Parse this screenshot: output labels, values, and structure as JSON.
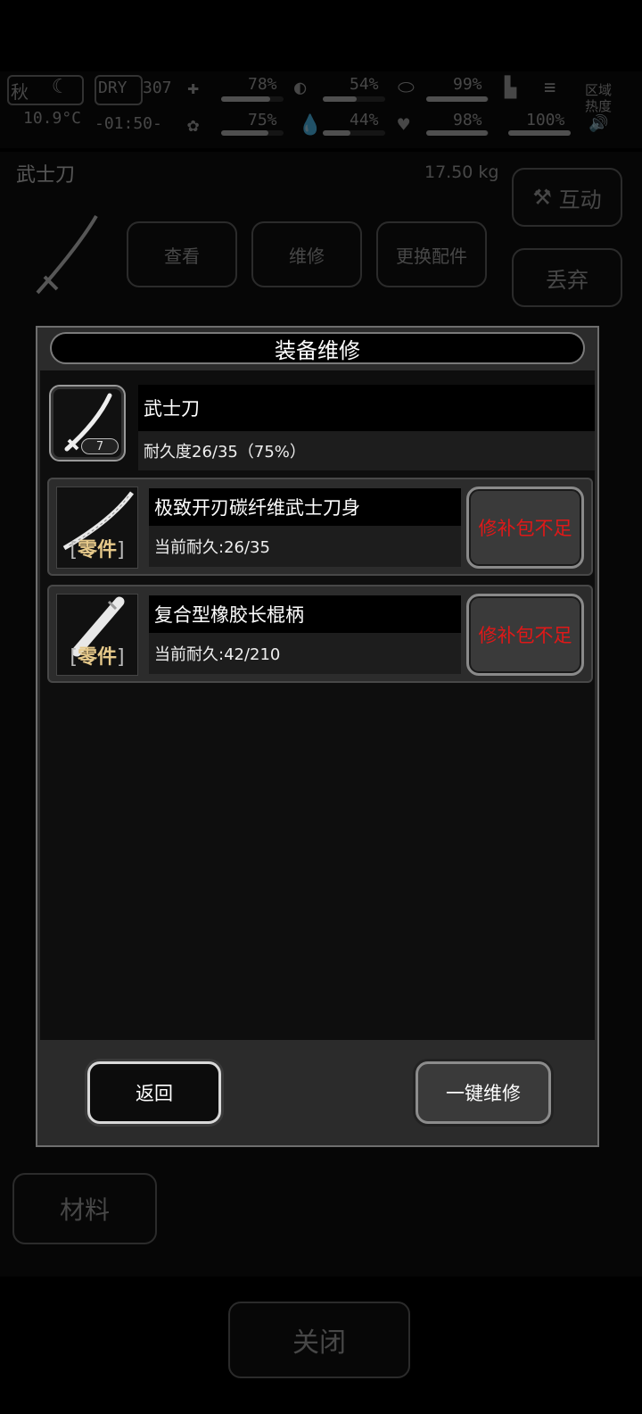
{
  "hud": {
    "season": "秋",
    "weather": "DRY",
    "weather_num": "307",
    "temperature": "10.9°C",
    "clock": "-01:50-",
    "stats": [
      {
        "name": "health",
        "value": "78%"
      },
      {
        "name": "hunger",
        "value": "54%"
      },
      {
        "name": "stomach",
        "value": "99%"
      },
      {
        "name": "stamina",
        "value": "100%"
      },
      {
        "name": "mind",
        "value": "75%"
      },
      {
        "name": "thirst",
        "value": "44%"
      },
      {
        "name": "heart",
        "value": "98%"
      }
    ],
    "zone_label": "区域热度"
  },
  "background": {
    "item_name": "武士刀",
    "item_weight": "17.50 kg",
    "btn_view": "查看",
    "btn_repair": "维修",
    "btn_swap": "更换配件",
    "btn_interact": "互动",
    "btn_discard": "丢弃",
    "side_material": "材料",
    "btn_close": "关闭"
  },
  "modal": {
    "title": "装备维修",
    "item": {
      "name": "武士刀",
      "level": "7",
      "durability": "耐久度26/35（75%）"
    },
    "parts": [
      {
        "name": "极致开刃碳纤维武士刀身",
        "tag": "零件",
        "durability": "当前耐久:26/35",
        "status": "修补包不足",
        "icon": "blade-icon"
      },
      {
        "name": "复合型橡胶长棍柄",
        "tag": "零件",
        "durability": "当前耐久:42/210",
        "status": "修补包不足",
        "icon": "handle-icon"
      }
    ],
    "back": "返回",
    "repair_all": "一键维修"
  },
  "colors": {
    "warning": "#e01818",
    "part_tag": "#e6c98a"
  }
}
